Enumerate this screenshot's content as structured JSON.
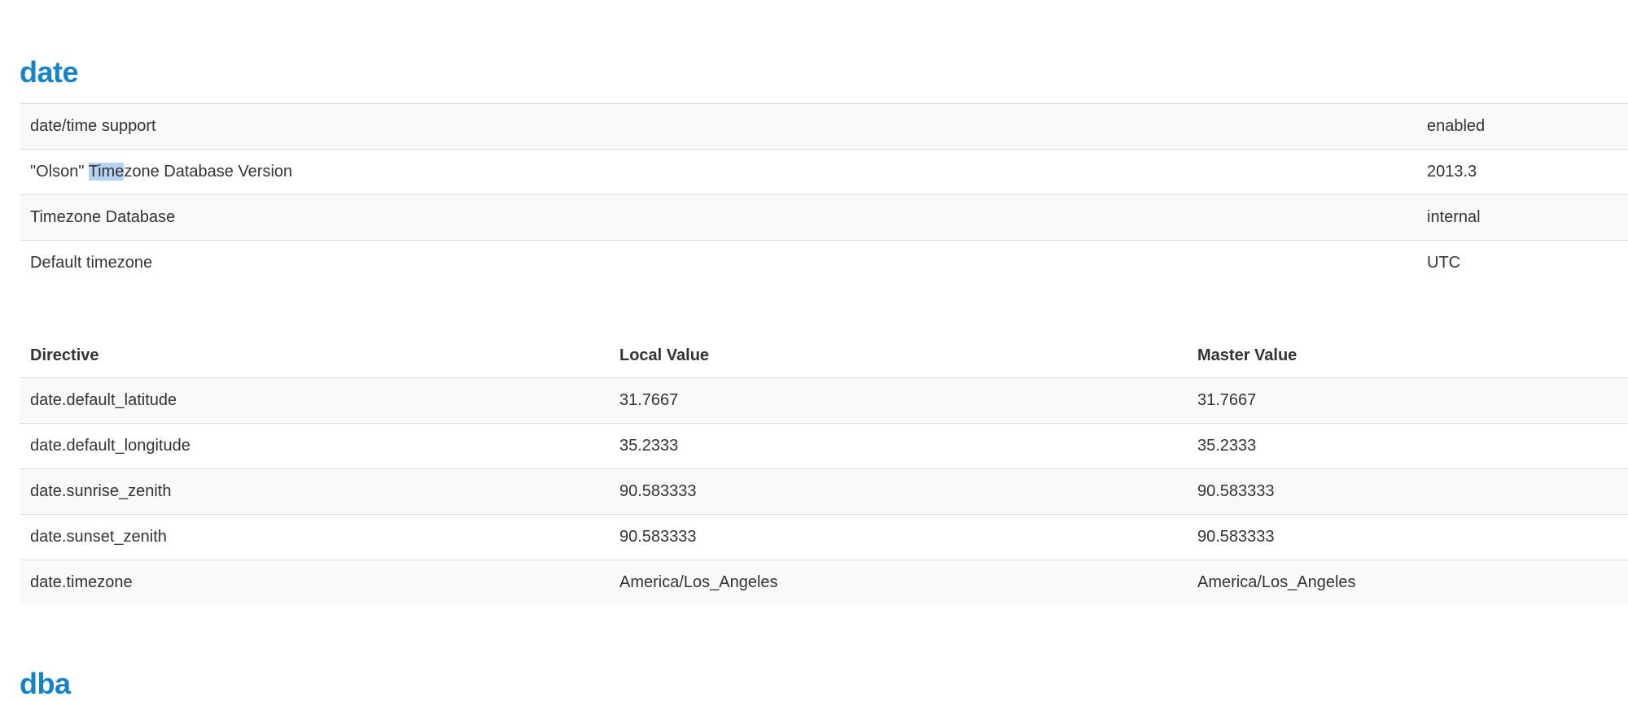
{
  "sections": {
    "date_title": "date",
    "next_title": "dba"
  },
  "info_rows": [
    {
      "key": "date/time support",
      "value": "enabled"
    },
    {
      "key_pre": "\"Olson\" ",
      "key_hl": "Time",
      "key_post": "zone Database Version",
      "value": "2013.3"
    },
    {
      "key": "Timezone Database",
      "value": "internal"
    },
    {
      "key": "Default timezone",
      "value": "UTC"
    }
  ],
  "directives": {
    "headers": [
      "Directive",
      "Local Value",
      "Master Value"
    ],
    "rows": [
      [
        "date.default_latitude",
        "31.7667",
        "31.7667"
      ],
      [
        "date.default_longitude",
        "35.2333",
        "35.2333"
      ],
      [
        "date.sunrise_zenith",
        "90.583333",
        "90.583333"
      ],
      [
        "date.sunset_zenith",
        "90.583333",
        "90.583333"
      ],
      [
        "date.timezone",
        "America/Los_Angeles",
        "America/Los_Angeles"
      ]
    ]
  },
  "colors": {
    "heading": "#1483c7",
    "text": "#333333",
    "row_alt": "#f9f9f9",
    "border": "#dcdcdc",
    "selection": "#b7d3f3"
  }
}
